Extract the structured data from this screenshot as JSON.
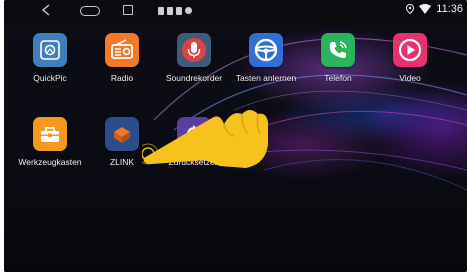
{
  "statusbar": {
    "time": "11:36",
    "nav": [
      "back-icon",
      "home-icon",
      "recent-apps-icon"
    ],
    "indicators": [
      "location-icon",
      "wifi-icon"
    ]
  },
  "apps": [
    {
      "label": "QuickPic",
      "icon": "quickpic-icon",
      "color": "#3f7fbf"
    },
    {
      "label": "Radio",
      "icon": "radio-icon",
      "color": "#f07a2a"
    },
    {
      "label": "Soundrekorder",
      "icon": "microphone-icon",
      "color": "#d94545"
    },
    {
      "label": "Tasten anlernen",
      "icon": "steering-wheel-icon",
      "color": "#2f6fd6"
    },
    {
      "label": "Telefon",
      "icon": "phone-icon",
      "color": "#29b35a"
    },
    {
      "label": "Video",
      "icon": "video-icon",
      "color": "#e6336e"
    },
    {
      "label": "Werkzeugkasten",
      "icon": "toolbox-icon",
      "color": "#f39a1e"
    },
    {
      "label": "ZLINK",
      "icon": "zlink-icon",
      "color": "#2b4d8a"
    },
    {
      "label": "Zurücksetzen",
      "icon": "reset-icon",
      "color": "#5b3fa0"
    }
  ],
  "colors": {
    "accent_hand": "#f7c21e",
    "background": "#0d0d14"
  }
}
